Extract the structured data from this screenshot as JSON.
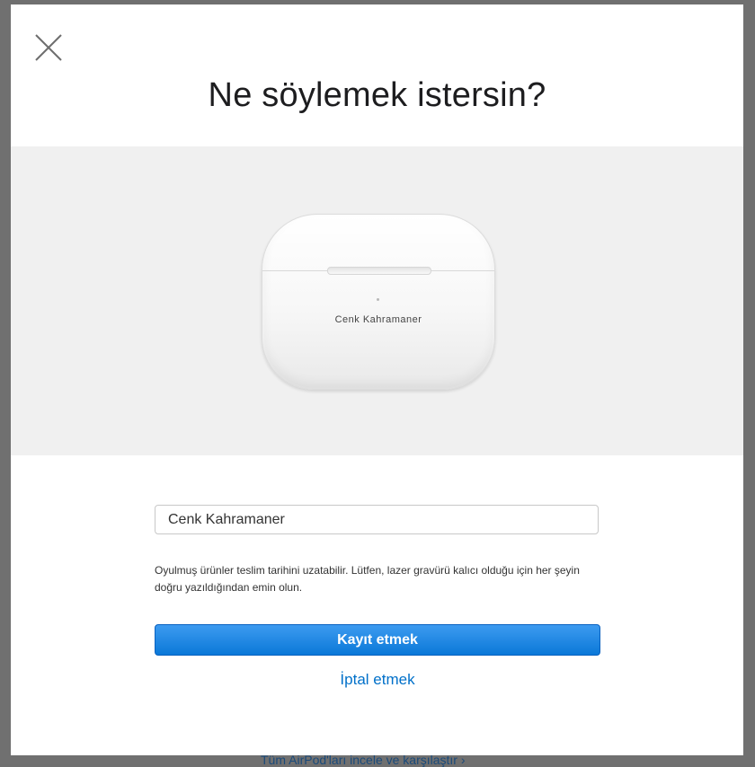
{
  "background": {
    "footer_link": "Tüm AirPod'ları incele ve karşılaştır ›"
  },
  "modal": {
    "close_icon": "close-icon",
    "title": "Ne söylemek istersin?",
    "preview": {
      "product": "AirPods case",
      "engraving_text": "Cenk Kahramaner"
    },
    "input_value": "Cenk Kahramaner",
    "notice": "Oyulmuş ürünler teslim tarihini uzatabilir. Lütfen, lazer gravürü kalıcı olduğu için her şeyin doğru yazıldığından emin olun.",
    "save_label": "Kayıt etmek",
    "cancel_label": "İptal etmek"
  },
  "colors": {
    "accent": "#0070c9",
    "button_top": "#3d9bf0",
    "button_bottom": "#0a78d8",
    "preview_bg": "#f0f0f0"
  }
}
